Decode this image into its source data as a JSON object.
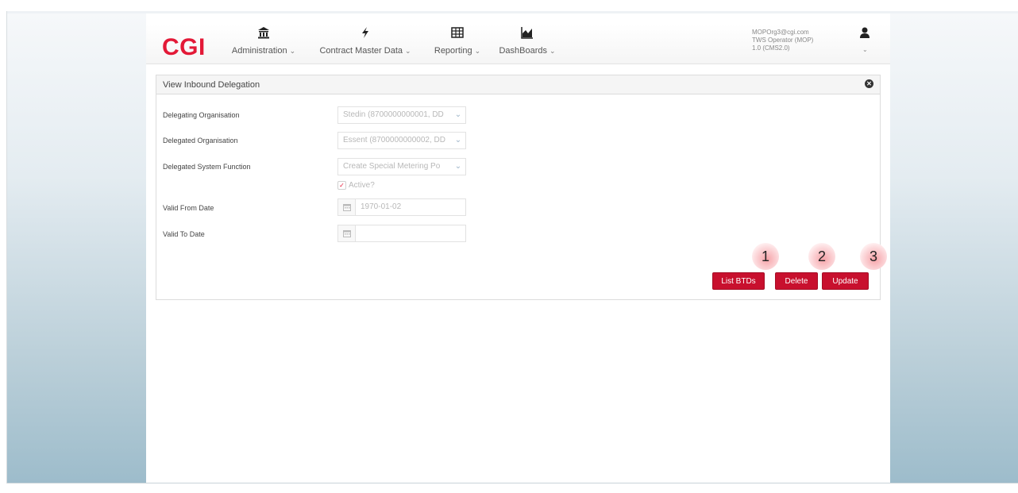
{
  "header": {
    "logo": "CGI",
    "nav": [
      {
        "label": "Administration",
        "icon": "bank-icon"
      },
      {
        "label": "Contract Master Data",
        "icon": "bolt-icon"
      },
      {
        "label": "Reporting",
        "icon": "table-icon"
      },
      {
        "label": "DashBoards",
        "icon": "area-chart-icon"
      }
    ],
    "user": {
      "email": "MOPOrg3@cgi.com",
      "role": "TWS Operator (MOP)",
      "version": "1.0 (CMS2.0)"
    }
  },
  "panel": {
    "title": "View Inbound Delegation",
    "fields": {
      "delegating_org_label": "Delegating Organisation",
      "delegating_org_value": "Stedin (8700000000001, DD",
      "delegated_org_label": "Delegated Organisation",
      "delegated_org_value": "Essent (8700000000002, DD",
      "system_function_label": "Delegated System Function",
      "system_function_value": "Create Special Metering Po",
      "active_label": "Active?",
      "active_checked": true,
      "valid_from_label": "Valid From Date",
      "valid_from_value": "1970-01-02",
      "valid_to_label": "Valid To Date",
      "valid_to_value": ""
    },
    "buttons": {
      "list_btds": "List BTDs",
      "delete": "Delete",
      "update": "Update"
    }
  },
  "callouts": [
    "1",
    "2",
    "3"
  ],
  "colors": {
    "brand_red": "#e31937",
    "button_red": "#c8102e"
  }
}
